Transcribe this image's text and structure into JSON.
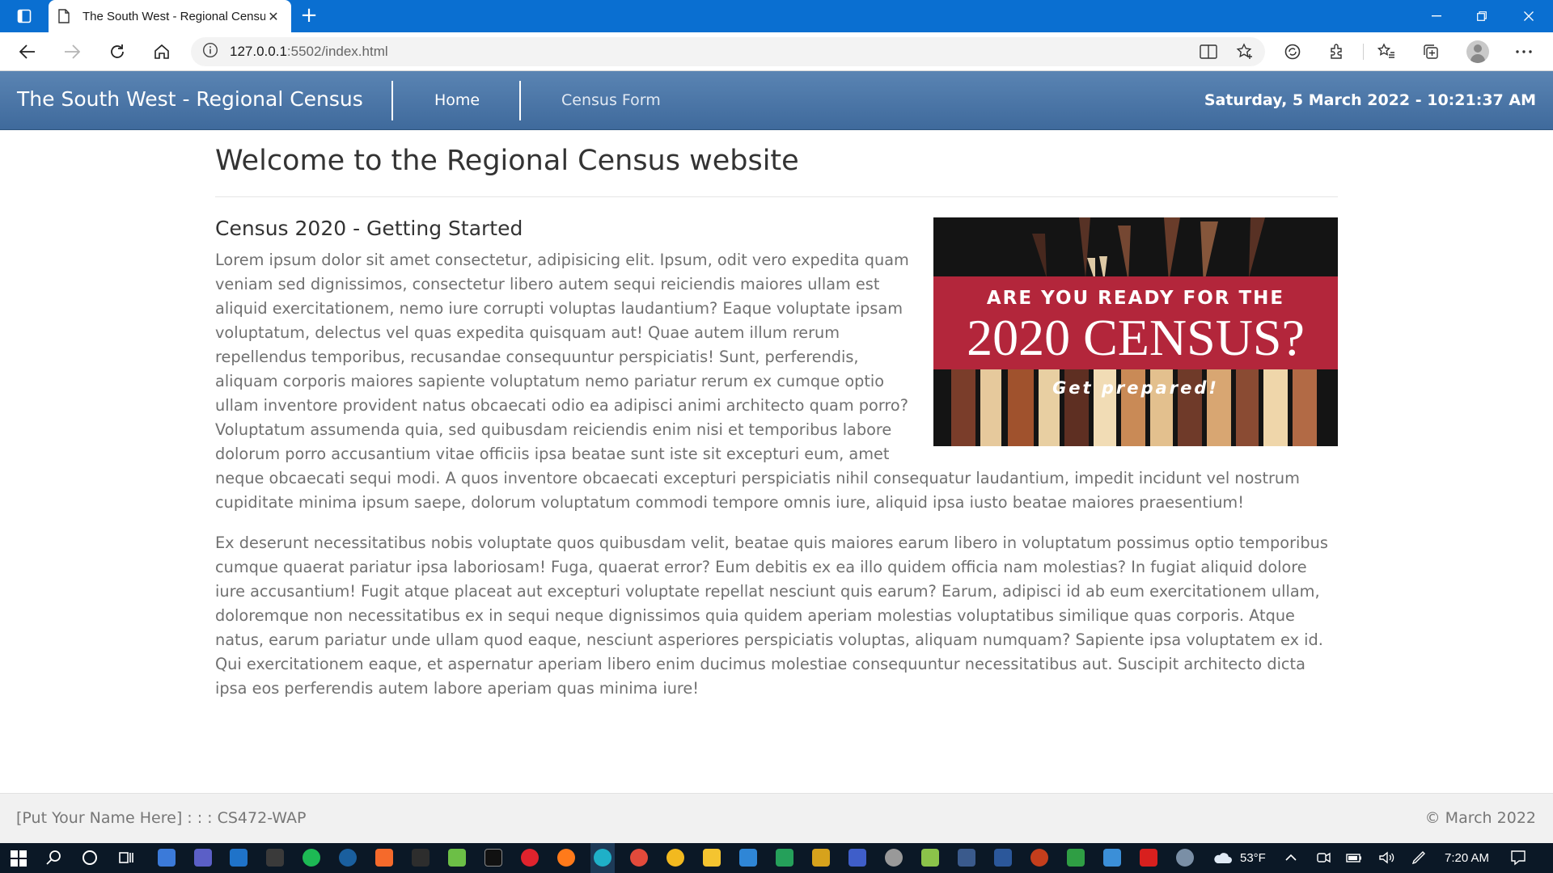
{
  "browser": {
    "tab_title": "The South West - Regional Census",
    "url_host": "127.0.0.1",
    "url_rest": ":5502/index.html"
  },
  "site": {
    "brand": "The South West - Regional Census",
    "nav": [
      {
        "label": "Home"
      },
      {
        "label": "Census Form"
      }
    ],
    "datetime": "Saturday, 5 March 2022 - 10:21:37 AM"
  },
  "main": {
    "title": "Welcome to the Regional Census website",
    "section_title": "Census 2020 - Getting Started",
    "paragraphs": [
      "Lorem ipsum dolor sit amet consectetur, adipisicing elit. Ipsum, odit vero expedita quam veniam sed dignissimos, consectetur libero autem sequi reiciendis maiores ullam est aliquid exercitationem, nemo iure corrupti voluptas laudantium? Eaque voluptate ipsam voluptatum, delectus vel quas expedita quisquam aut! Quae autem illum rerum repellendus temporibus, recusandae consequuntur perspiciatis! Sunt, perferendis, aliquam corporis maiores sapiente voluptatum nemo pariatur rerum ex cumque optio ullam inventore provident natus obcaecati odio ea adipisci animi architecto quam porro? Voluptatum assumenda quia, sed quibusdam reiciendis enim nisi et temporibus labore dolorum porro accusantium vitae officiis ipsa beatae sunt iste sit excepturi eum, amet neque obcaecati sequi modi. A quos inventore obcaecati excepturi perspiciatis nihil consequatur laudantium, impedit incidunt vel nostrum cupiditate minima ipsum saepe, dolorum voluptatum commodi tempore omnis iure, aliquid ipsa iusto beatae maiores praesentium!",
      "Ex deserunt necessitatibus nobis voluptate quos quibusdam velit, beatae quis maiores earum libero in voluptatum possimus optio temporibus cumque quaerat pariatur ipsa laboriosam! Fuga, quaerat error? Eum debitis ex ea illo quidem officia nam molestias? In fugiat aliquid dolore iure accusantium! Fugit atque placeat aut excepturi voluptate repellat nesciunt quis earum? Earum, adipisci id ab eum exercitationem ullam, doloremque non necessitatibus ex in sequi neque dignissimos quia quidem aperiam molestias voluptatibus similique quas corporis. Atque natus, earum pariatur unde ullam quod eaque, nesciunt asperiores perspiciatis voluptas, aliquam numquam? Sapiente ipsa voluptatem ex id. Qui exercitationem eaque, et aspernatur aperiam libero enim ducimus molestiae consequuntur necessitatibus aut. Suscipit architecto dicta ipsa eos perferendis autem labore aperiam quas minima iure!"
    ],
    "image": {
      "line1": "ARE YOU READY FOR THE",
      "line2": "2020 CENSUS?",
      "line3": "Get prepared!"
    }
  },
  "footer": {
    "left": "[Put Your Name Here] : : : CS472-WAP",
    "right": "© March 2022"
  },
  "taskbar": {
    "weather": "53°F",
    "time": "7:20 AM"
  },
  "colors": {
    "nav_top": "#5a84b3",
    "nav_bottom": "#3f6a9c",
    "chrome": "#0a6fd1",
    "banner_red": "#b3263b"
  }
}
